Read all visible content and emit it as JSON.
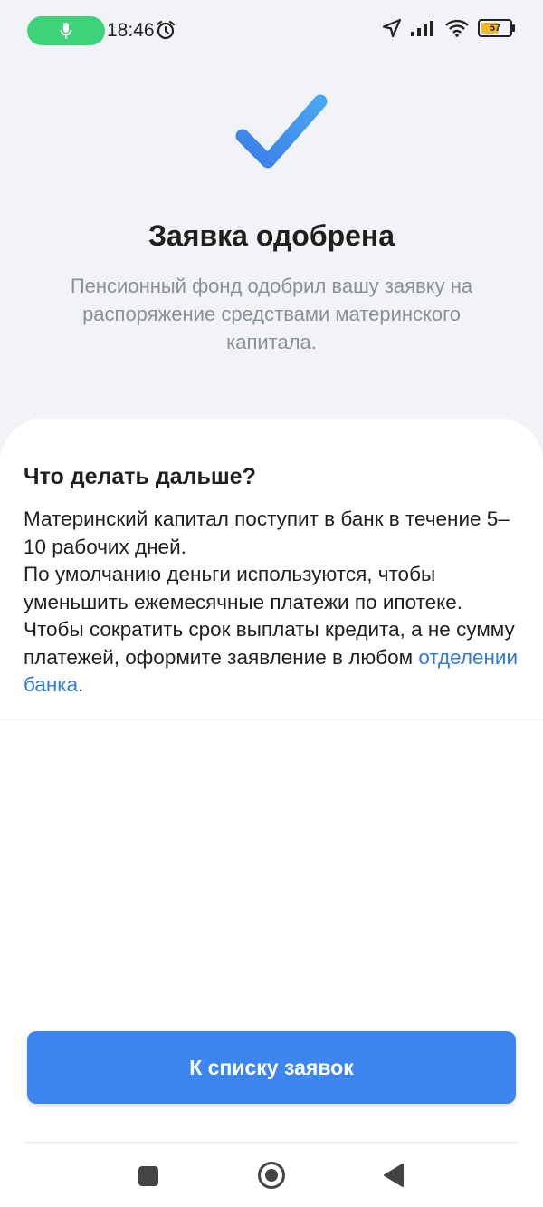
{
  "status_bar": {
    "time": "18:46",
    "battery_level": "57",
    "icons": [
      "mic-icon",
      "alarm-icon",
      "location-icon",
      "signal-icon",
      "wifi-icon",
      "battery-icon"
    ]
  },
  "header": {
    "title": "Заявка одобрена",
    "subtitle": "Пенсионный фонд одобрил вашу заявку на распоряжение средствами материнского капитала."
  },
  "card": {
    "title": "Что делать дальше?",
    "line1": "Материнский капитал поступит в банк в течение 5–10 рабочих дней.",
    "line2": "По умолчанию деньги используются, чтобы уменьшить ежемесячные платежи по ипотеке. Чтобы сократить срок выплаты кредита, а не сумму платежей, оформите заявление в любом ",
    "link_text": "отделении банка",
    "line2_end": "."
  },
  "actions": {
    "primary_label": "К списку заявок"
  },
  "colors": {
    "accent": "#3d86ef",
    "link": "#2f7bd6",
    "check": "#3d86ef",
    "mic_pill": "#3ed37a",
    "battery": "#f2b72a"
  }
}
